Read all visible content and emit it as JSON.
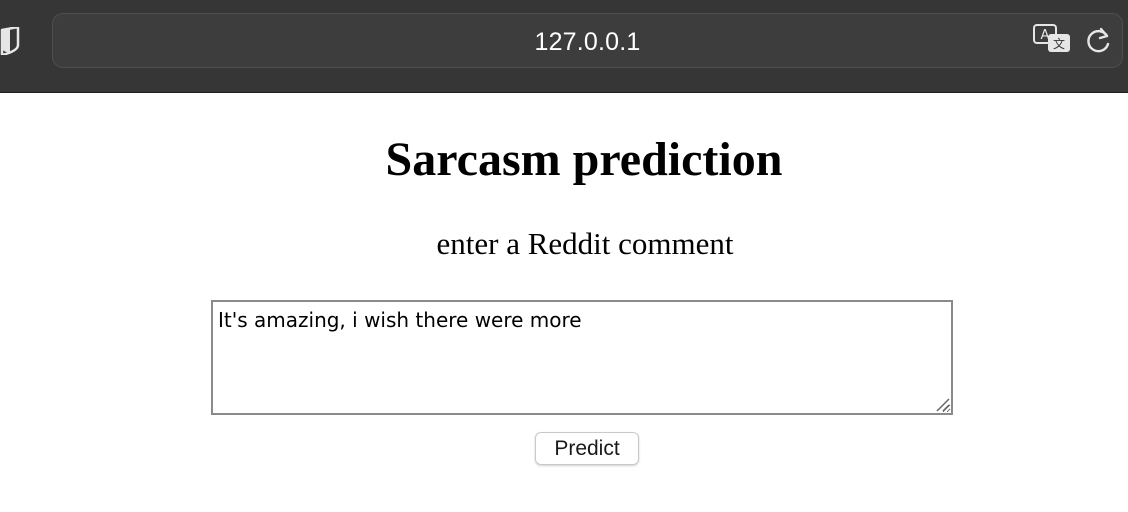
{
  "browser": {
    "url": "127.0.0.1",
    "icons": [
      "shield-icon",
      "translate-icon",
      "reload-icon"
    ],
    "colors": {
      "toolbar": "#363636",
      "urlbar": "#3d3d3d",
      "url_text": "#ffffff"
    }
  },
  "page": {
    "title": "Sarcasm prediction",
    "subtitle": "enter a Reddit comment",
    "comment_value": "It's amazing, i wish there were more",
    "predict_label": "Predict"
  }
}
